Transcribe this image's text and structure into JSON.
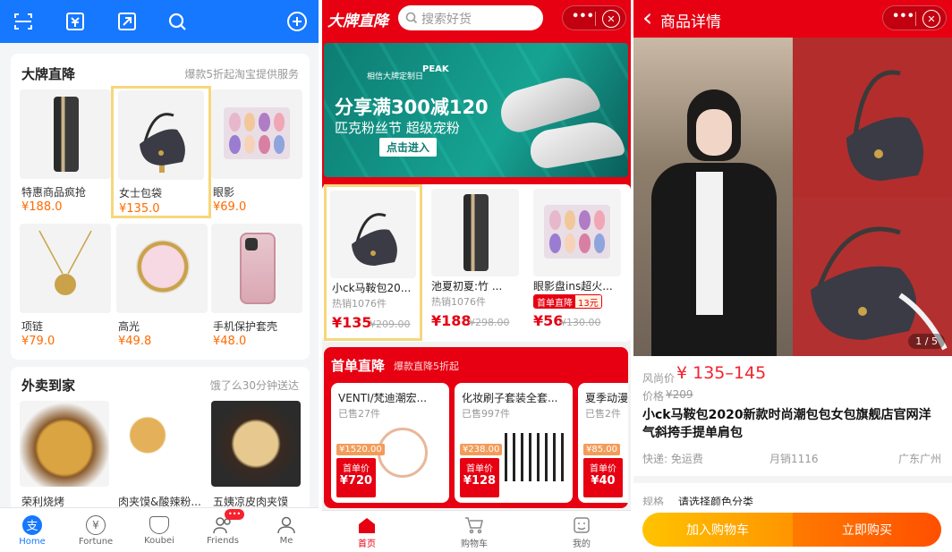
{
  "panel1": {
    "section1": {
      "title": "大牌直降",
      "subtitle": "爆款5折起淘宝提供服务",
      "items": [
        {
          "name": "特惠商品疯抢",
          "price": "¥188.0"
        },
        {
          "name": "女士包袋",
          "price": "¥135.0"
        },
        {
          "name": "眼影",
          "price": "¥69.0"
        },
        {
          "name": "项链",
          "price": "¥79.0"
        },
        {
          "name": "高光",
          "price": "¥49.8"
        },
        {
          "name": "手机保护套壳",
          "price": "¥48.0"
        }
      ]
    },
    "section2": {
      "title": "外卖到家",
      "subtitle": "饿了么30分钟送达",
      "items": [
        {
          "name": "荣利烧烤"
        },
        {
          "name": "肉夹馍&酸辣粉..."
        },
        {
          "name": "五姨凉皮肉夹馍"
        }
      ]
    },
    "tabbar": [
      {
        "label": "Home",
        "icon": "alipay-icon"
      },
      {
        "label": "Fortune",
        "icon": "yen-icon"
      },
      {
        "label": "Koubei",
        "icon": "koubei-icon"
      },
      {
        "label": "Friends",
        "icon": "friends-icon",
        "badge": "•••"
      },
      {
        "label": "Me",
        "icon": "person-icon"
      }
    ],
    "colors": {
      "blue": "#1677ff",
      "price": "#ff6a00",
      "highlight": "#f6d77a"
    }
  },
  "panel2": {
    "header": {
      "logo": "大牌直降",
      "search_placeholder": "搜索好货",
      "more": "•••"
    },
    "banner": {
      "brand": "相信大牌定制日",
      "brand2": "PEAK",
      "headline": "分享满300减120",
      "sub": "匹克粉丝节  超级宠粉",
      "cta": "点击进入"
    },
    "products": [
      {
        "name": "小ck马鞍包20...",
        "sold": "热销1076件",
        "price": "¥135",
        "orig": "¥209.00"
      },
      {
        "name": "池夏初夏:竹 ...",
        "sold": "热销1076件",
        "price": "¥188",
        "orig": "¥298.00"
      },
      {
        "name": "眼影盘ins超火...",
        "tag": "首单直降",
        "tag_value": "13元",
        "price": "¥56",
        "orig": "¥130.00"
      }
    ],
    "firstorder": {
      "title": "首单直降",
      "subtitle": "爆款直降5折起",
      "items": [
        {
          "name": "VENTI/梵迪潮宏...",
          "sold": "已售27件",
          "orig": "¥1520.00",
          "label": "首单价",
          "price": "¥720"
        },
        {
          "name": "化妆刷子套装全套...",
          "sold": "已售997件",
          "orig": "¥238.00",
          "label": "首单价",
          "price": "¥128"
        },
        {
          "name": "夏季动漫",
          "sold": "已售2件",
          "orig": "¥85.00",
          "label": "首单价",
          "price": "¥40"
        }
      ]
    },
    "tabbar": [
      {
        "label": "首页",
        "icon": "home-icon"
      },
      {
        "label": "购物车",
        "icon": "cart-icon"
      },
      {
        "label": "我的",
        "icon": "profile-icon"
      }
    ],
    "colors": {
      "red": "#e60012"
    }
  },
  "panel3": {
    "header": {
      "back": "‹",
      "title": "商品详情",
      "more": "•••"
    },
    "image_counter": "1 / 5",
    "price_label": "风尚价",
    "price": "¥ 135–145",
    "orig_label": "价格",
    "orig_price": "¥209",
    "title": "小ck马鞍包2020新款时尚潮包包女包旗舰店官网洋气斜挎手提单肩包",
    "shipping": "快递: 免运费",
    "monthly": "月销1116",
    "location": "广东广州",
    "spec_label": "规格",
    "spec_value": "请选择颜色分类",
    "add_cart": "加入购物车",
    "buy_now": "立即购买"
  }
}
